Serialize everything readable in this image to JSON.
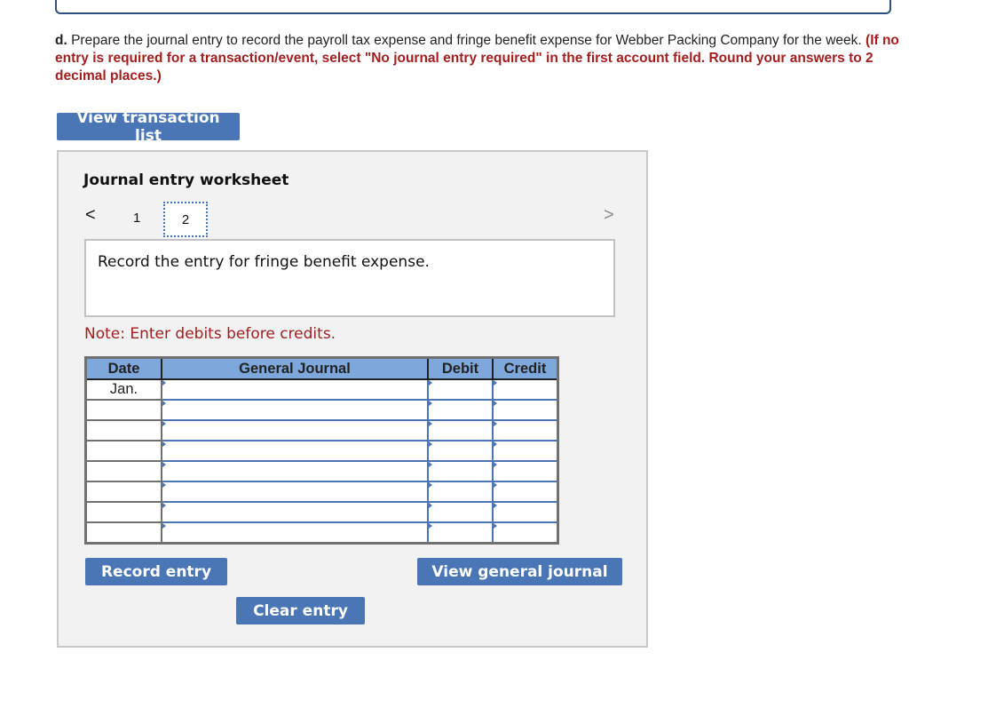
{
  "question": {
    "label": "d.",
    "text": "Prepare the journal entry to record the payroll tax expense and fringe benefit expense for Webber Packing Company for the week.",
    "instruction": "(If no entry is required for a transaction/event, select \"No journal entry required\" in the first account field. Round your answers to 2 decimal places.)"
  },
  "buttons": {
    "view_transaction_list": "View transaction list",
    "record_entry": "Record entry",
    "view_general_journal": "View general journal",
    "clear_entry": "Clear entry"
  },
  "worksheet": {
    "title": "Journal entry worksheet",
    "nav": {
      "prev": "<",
      "next": ">",
      "pages": [
        "1",
        "2"
      ],
      "current_page": "2"
    },
    "description": "Record the entry for fringe benefit expense.",
    "note": "Note: Enter debits before credits."
  },
  "journal": {
    "headers": [
      "Date",
      "General Journal",
      "Debit",
      "Credit"
    ],
    "rows": [
      {
        "date": "Jan.",
        "account": "",
        "debit": "",
        "credit": ""
      },
      {
        "date": "",
        "account": "",
        "debit": "",
        "credit": ""
      },
      {
        "date": "",
        "account": "",
        "debit": "",
        "credit": ""
      },
      {
        "date": "",
        "account": "",
        "debit": "",
        "credit": ""
      },
      {
        "date": "",
        "account": "",
        "debit": "",
        "credit": ""
      },
      {
        "date": "",
        "account": "",
        "debit": "",
        "credit": ""
      },
      {
        "date": "",
        "account": "",
        "debit": "",
        "credit": ""
      },
      {
        "date": "",
        "account": "",
        "debit": "",
        "credit": ""
      }
    ]
  },
  "colors": {
    "accent": "#4a76b5",
    "header_blue": "#7ea7dc",
    "instruction_red": "#a31f1f"
  }
}
